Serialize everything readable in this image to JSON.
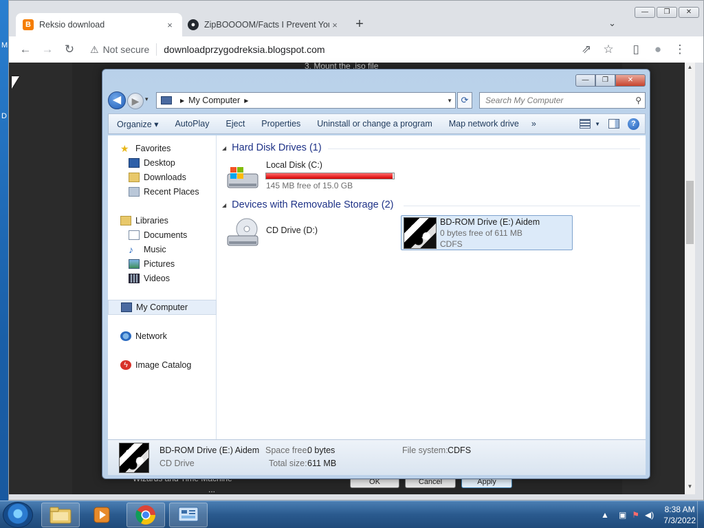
{
  "desktop": {
    "peek_left_1": "M",
    "peek_left_2": "D"
  },
  "browser": {
    "tabs": [
      {
        "title": "Reksio download",
        "favicon_letter": "B",
        "favicon_color": "#f57d00",
        "close": "×"
      },
      {
        "title": "ZipBOOOOM/Facts I Prevent You",
        "favicon_letter": "●",
        "favicon_color": "#24292f",
        "close": "×"
      }
    ],
    "new_tab": "+",
    "tab_search": "⌄",
    "window_buttons": [
      "—",
      "❐",
      "✕"
    ],
    "back": "←",
    "forward": "→",
    "reload": "↻",
    "security_icon": "⚠",
    "security_text": "Not secure",
    "url": "downloadprzygodreksia.blogspot.com",
    "share": "⇗",
    "bookmark": "☆",
    "sidepanel": "▯",
    "profile": "●",
    "menu": "⋮"
  },
  "page": {
    "top_text": "3. Mount the .iso file",
    "bottom_text_1": "Wizards and Time Machine",
    "bottom_text_2": "...",
    "dialog_buttons": [
      "OK",
      "Cancel",
      "Apply"
    ]
  },
  "explorer": {
    "window_buttons": [
      "—",
      "❐",
      "✕"
    ],
    "back": "◀",
    "forward": "▶",
    "history": "▾",
    "breadcrumb": "My Computer",
    "breadcrumb_arrow": "▶",
    "address_dropdown": "▼",
    "refresh": "⟳",
    "search_placeholder": "Search My Computer",
    "search_icon": "⚲",
    "commands": [
      "Organize ▾",
      "AutoPlay",
      "Eject",
      "Properties",
      "Uninstall or change a program",
      "Map network drive",
      "»"
    ],
    "view_dropdown": "▼",
    "help": "?",
    "nav": {
      "favorites": "Favorites",
      "desktop": "Desktop",
      "downloads": "Downloads",
      "recent": "Recent Places",
      "libraries": "Libraries",
      "documents": "Documents",
      "music": "Music",
      "pictures": "Pictures",
      "videos": "Videos",
      "mycomputer": "My Computer",
      "network": "Network",
      "imagecatalog": "Image Catalog"
    },
    "groups": {
      "hdd": "Hard Disk Drives (1)",
      "removable": "Devices with Removable Storage (2)",
      "toggle": "◢"
    },
    "drives": {
      "c": {
        "name": "Local Disk (C:)",
        "info": "145 MB free of 15.0 GB",
        "used_fraction": 0.99
      },
      "d": {
        "name": "CD Drive (D:)"
      },
      "e": {
        "name": "BD-ROM Drive (E:) Aidem",
        "info": "0 bytes free of 611 MB",
        "fs": "CDFS"
      }
    },
    "details": {
      "name": "BD-ROM Drive (E:) Aidem",
      "type": "CD Drive",
      "space_free_label": "Space free:",
      "space_free": "0 bytes",
      "total_size_label": "Total size:",
      "total_size": "611 MB",
      "fs_label": "File system:",
      "fs": "CDFS"
    }
  },
  "taskbar": {
    "time": "8:38 AM",
    "date": "7/3/2022",
    "tray_arrow": "▲"
  },
  "colors": {
    "accent": "#1e3287",
    "capacity_full": "#d40000",
    "selection": "#dceaf9"
  }
}
